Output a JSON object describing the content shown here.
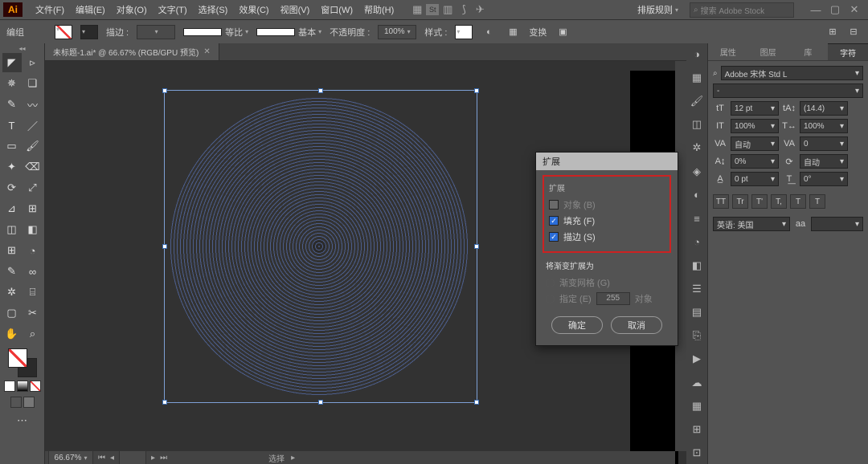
{
  "menubar": {
    "items": [
      "文件(F)",
      "编辑(E)",
      "对象(O)",
      "文字(T)",
      "选择(S)",
      "效果(C)",
      "视图(V)",
      "窗口(W)",
      "帮助(H)"
    ],
    "workspace_label": "排版规则",
    "search_placeholder": "搜索 Adobe Stock"
  },
  "optbar": {
    "selection_label": "编组",
    "stroke_label": "描边 :",
    "stroke_weight": "",
    "stroke_prof_label": "等比",
    "brush_label": "基本",
    "opacity_label": "不透明度 :",
    "opacity_value": "100%",
    "style_label": "样式 :",
    "transform_label": "变换"
  },
  "doc_tab": {
    "label": "未标题-1.ai* @ 66.67% (RGB/GPU 预览)"
  },
  "status": {
    "zoom": "66.67%",
    "tool": "选择"
  },
  "panels": {
    "tabs": [
      "属性",
      "图层",
      "库",
      "字符"
    ],
    "active_tab": 3,
    "font_family": "Adobe 宋体 Std L",
    "font_style": "-",
    "size_icon": "tT",
    "size": "12 pt",
    "leading_icon": "tA↕",
    "leading": "(14.4)",
    "vscale_icon": "IT",
    "vscale": "100%",
    "hscale_icon": "T↔",
    "hscale": "100%",
    "kerning_icon": "VA",
    "kerning": "自动",
    "tracking_icon": "VA",
    "tracking": "0",
    "baseline_shift": "0%",
    "rotate": "自动",
    "aa_a": "0 pt",
    "aa_b": "0°",
    "lang_label": "英语: 美国",
    "aa_label": "aa",
    "typebtns": [
      "TT",
      "Tr",
      "T'",
      "T,",
      "T",
      "T"
    ]
  },
  "dialog": {
    "title": "扩展",
    "section1_title": "扩展",
    "opt_object": "对象 (B)",
    "opt_fill": "填充 (F)",
    "opt_stroke": "描边 (S)",
    "section2_title": "将渐变扩展为",
    "opt_mesh": "渐变网格 (G)",
    "opt_specify": "指定 (E)",
    "specify_value": "255",
    "specify_unit": "对象",
    "ok": "确定",
    "cancel": "取消"
  },
  "tools": [
    "selection",
    "direct-selection",
    "magic-wand",
    "lasso",
    "pen",
    "curvature",
    "type",
    "line",
    "rectangle",
    "paintbrush",
    "shaper",
    "eraser",
    "rotate",
    "scale",
    "width",
    "free-transform",
    "shape-builder",
    "perspective",
    "mesh",
    "gradient",
    "eyedropper",
    "blend",
    "symbol-sprayer",
    "column-graph",
    "artboard",
    "slice",
    "hand",
    "zoom"
  ],
  "dock_icons": [
    "color",
    "swatches",
    "brushes",
    "styles",
    "symbols",
    "appearance",
    "color-guide",
    "stroke",
    "gradient",
    "transparency",
    "layers",
    "artboards",
    "links",
    "actions",
    "libraries",
    "align",
    "pathfinder",
    "transform"
  ]
}
